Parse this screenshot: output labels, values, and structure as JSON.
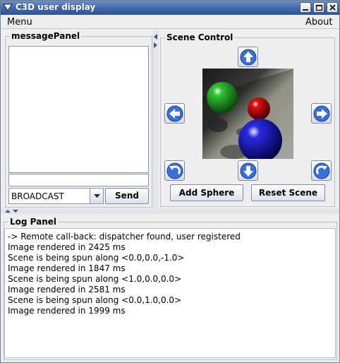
{
  "window": {
    "title": "C3D user display"
  },
  "menubar": {
    "menu": "Menu",
    "about": "About"
  },
  "message_panel": {
    "title": "messagePanel",
    "text": "",
    "input": "",
    "target_select": "BROADCAST",
    "send": "Send"
  },
  "scene_control": {
    "title": "Scene Control",
    "add_sphere": "Add Sphere",
    "reset_scene": "Reset Scene",
    "spheres": [
      "green",
      "red",
      "blue"
    ]
  },
  "log_panel": {
    "title": "Log Panel",
    "lines": [
      "-> Remote call-back: dispatcher found, user registered",
      "Image rendered in 2425 ms",
      "Scene is being spun along <0.0,0.0,-1.0>",
      "Image rendered in 1847 ms",
      "Scene is being spun along <1.0,0.0,0.0>",
      "Image rendered in 2581 ms",
      "Scene is being spun along <0.0,1.0,0.0>",
      "Image rendered in 1999 ms"
    ]
  },
  "colors": {
    "titlebar": "#3f67a8",
    "button_arrow": "#3a6fd8"
  }
}
